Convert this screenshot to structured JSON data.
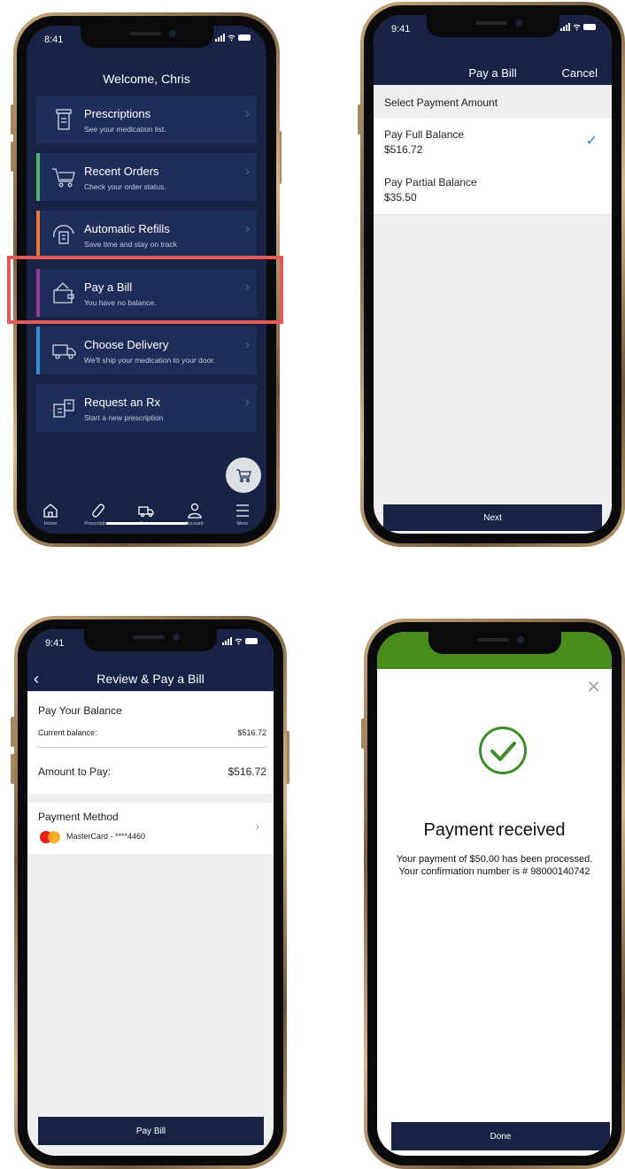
{
  "screen_home": {
    "status_time": "8:41",
    "welcome": "Welcome, Chris",
    "menu": [
      {
        "title": "Prescriptions",
        "subtitle": "See your medication list.",
        "accent": "#1f2e58"
      },
      {
        "title": "Recent Orders",
        "subtitle": "Check your order status.",
        "accent": "#4bb56e"
      },
      {
        "title": "Automatic Refills",
        "subtitle": "Save time and stay on track",
        "accent": "#e9743a"
      },
      {
        "title": "Pay a Bill",
        "subtitle": "You have no balance.",
        "accent": "#8e3b96"
      },
      {
        "title": "Choose Delivery",
        "subtitle": "We'll ship your medication to your door.",
        "accent": "#2d8fd8"
      },
      {
        "title": "Request an Rx",
        "subtitle": "Start a new prescription",
        "accent": "#1f2e58"
      }
    ],
    "tabs": [
      "Home",
      "Prescriptions",
      "Orders",
      "Account",
      "More"
    ],
    "highlight_color": "#e35a5a"
  },
  "screen_select": {
    "status_time": "9:41",
    "title": "Pay a Bill",
    "cancel": "Cancel",
    "section": "Select Payment Amount",
    "options": [
      {
        "label": "Pay Full Balance",
        "amount": "$516.72",
        "selected": true
      },
      {
        "label": "Pay Partial Balance",
        "amount": "$35.50",
        "selected": false
      }
    ],
    "next": "Next",
    "check_symbol": "✓"
  },
  "screen_review": {
    "status_time": "9:41",
    "title": "Review & Pay a Bill",
    "pay_balance_title": "Pay Your Balance",
    "current_balance_label": "Current balance:",
    "current_balance_value": "$516.72",
    "amount_to_pay_label": "Amount to Pay:",
    "amount_to_pay_value": "$516.72",
    "payment_method_title": "Payment Method",
    "payment_card": "MasterCard - ****4460",
    "pay_button": "Pay Bill"
  },
  "screen_confirm": {
    "heading": "Payment received",
    "message": "Your payment of $50.00 has been processed. Your confirmation number is # 98000140742",
    "done": "Done",
    "accent": "#4a8c1c"
  },
  "colors": {
    "navy": "#172244",
    "card": "#1f2e58",
    "success": "#3d8b2a",
    "check_blue": "#1a7fd6"
  }
}
